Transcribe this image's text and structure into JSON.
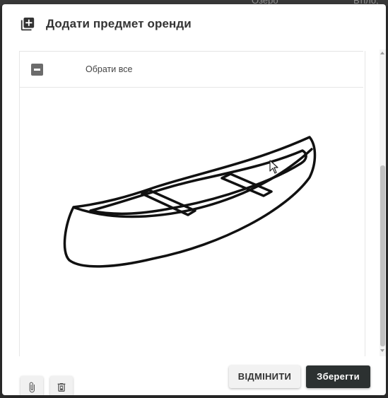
{
  "background": {
    "fragments": [
      "Озеро",
      "Втіло,"
    ]
  },
  "dialog": {
    "title": "Додати предмет оренди",
    "title_icon": "add-to-library-icon"
  },
  "selection": {
    "select_all_label": "Обрати все",
    "toggle_icon": "minus-checkbox-icon"
  },
  "image": {
    "subject": "canoe",
    "icon": "canoe-line-drawing"
  },
  "file_actions": {
    "attach_icon": "paperclip-icon",
    "delete_icon": "delete-file-icon"
  },
  "footer": {
    "cancel_label": "ВІДМІНИТИ",
    "save_label": "Зберегти"
  },
  "colors": {
    "save_button": "#2c3131",
    "cancel_button": "#f2f2f2",
    "toggle": "#6b6b6b"
  }
}
